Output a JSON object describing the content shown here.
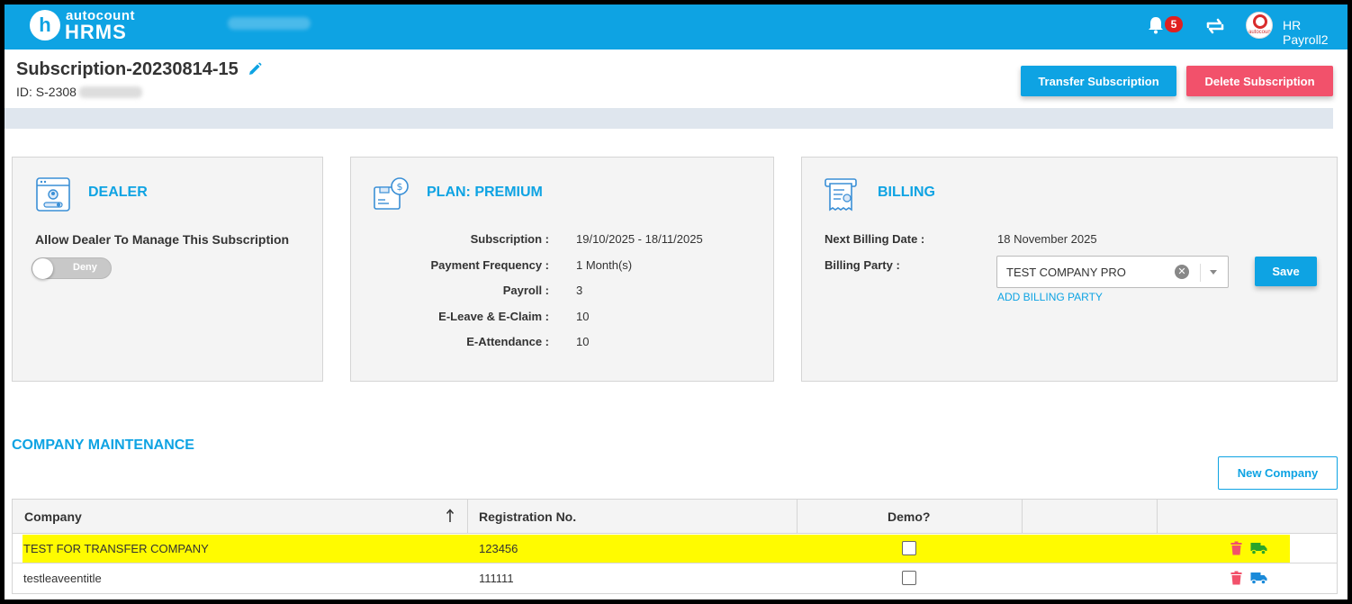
{
  "app": {
    "logo_letter": "h",
    "logo_line1": "autocount",
    "logo_line2": "HRMS",
    "notification_count": "5",
    "avatar_brand": "autocount",
    "username": "HR Payroll2"
  },
  "header": {
    "title": "Subscription-20230814-15",
    "id_label": "ID: S-2308",
    "transfer_label": "Transfer Subscription",
    "delete_label": "Delete Subscription"
  },
  "dealer": {
    "title": "DEALER",
    "label": "Allow Dealer To Manage This Subscription",
    "toggle_text": "Deny",
    "toggle_on": false
  },
  "plan": {
    "title": "PLAN: PREMIUM",
    "rows": [
      {
        "label": "Subscription :",
        "value": "19/10/2025 - 18/11/2025"
      },
      {
        "label": "Payment Frequency :",
        "value": "1 Month(s)"
      },
      {
        "label": "Payroll :",
        "value": "3"
      },
      {
        "label": "E-Leave & E-Claim :",
        "value": "10"
      },
      {
        "label": "E-Attendance :",
        "value": "10"
      }
    ]
  },
  "billing": {
    "title": "BILLING",
    "next_date_label": "Next Billing Date :",
    "next_date_value": "18 November 2025",
    "party_label": "Billing Party :",
    "party_value": "TEST COMPANY PRO",
    "clear_symbol": "✕",
    "add_party_label": "ADD BILLING PARTY",
    "save_label": "Save"
  },
  "company": {
    "section_title": "COMPANY MAINTENANCE",
    "new_label": "New Company",
    "columns": {
      "company": "Company",
      "registration": "Registration No.",
      "demo": "Demo?"
    },
    "rows": [
      {
        "company": "TEST FOR TRANSFER COMPANY",
        "registration": "123456",
        "demo": false,
        "highlighted": true
      },
      {
        "company": "testleaveentitle",
        "registration": "111111",
        "demo": false,
        "highlighted": false
      }
    ]
  },
  "colors": {
    "primary": "#0ea3e3",
    "danger": "#f2516b",
    "highlight": "#fffb00",
    "truck_highlight": "#2aa52a",
    "truck_default": "#1a8ad9",
    "trash": "#f2516b"
  }
}
